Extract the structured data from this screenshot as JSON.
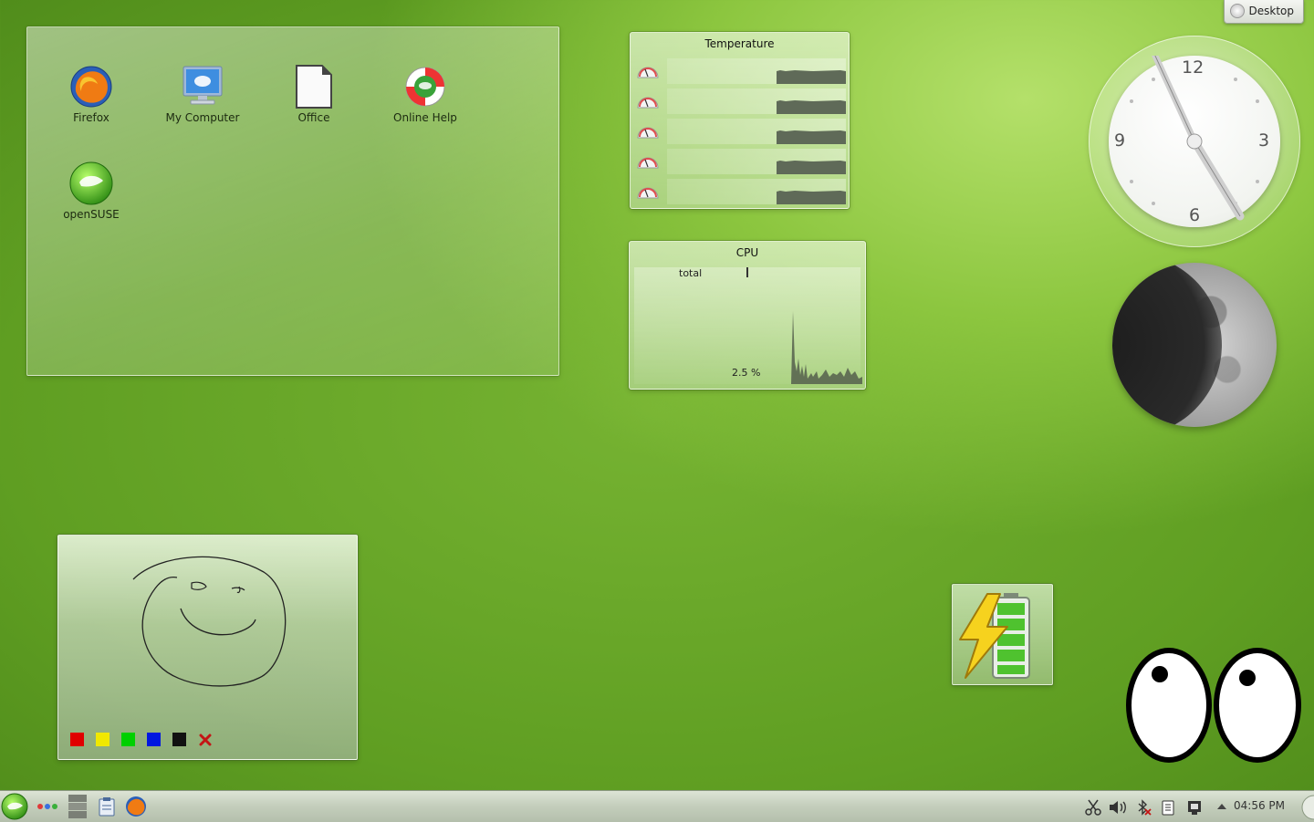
{
  "folder_view": {
    "icons": [
      {
        "label": "Firefox"
      },
      {
        "label": "My Computer"
      },
      {
        "label": "Office"
      },
      {
        "label": "Online Help"
      },
      {
        "label": "openSUSE"
      }
    ]
  },
  "temperature": {
    "title": "Temperature",
    "sensor_count": 5
  },
  "cpu": {
    "title": "CPU",
    "series_label": "total",
    "value_text": "2.5 %"
  },
  "clock": {
    "numerals": [
      "12",
      "3",
      "6",
      "9"
    ]
  },
  "notes": {
    "colors": [
      "#e00000",
      "#f0e800",
      "#00d000",
      "#0018e0",
      "#111111"
    ]
  },
  "desktop_button": {
    "label": "Desktop"
  },
  "panel": {
    "time": "04:56 PM"
  },
  "colors": {
    "accent_green": "#6fae2e"
  }
}
